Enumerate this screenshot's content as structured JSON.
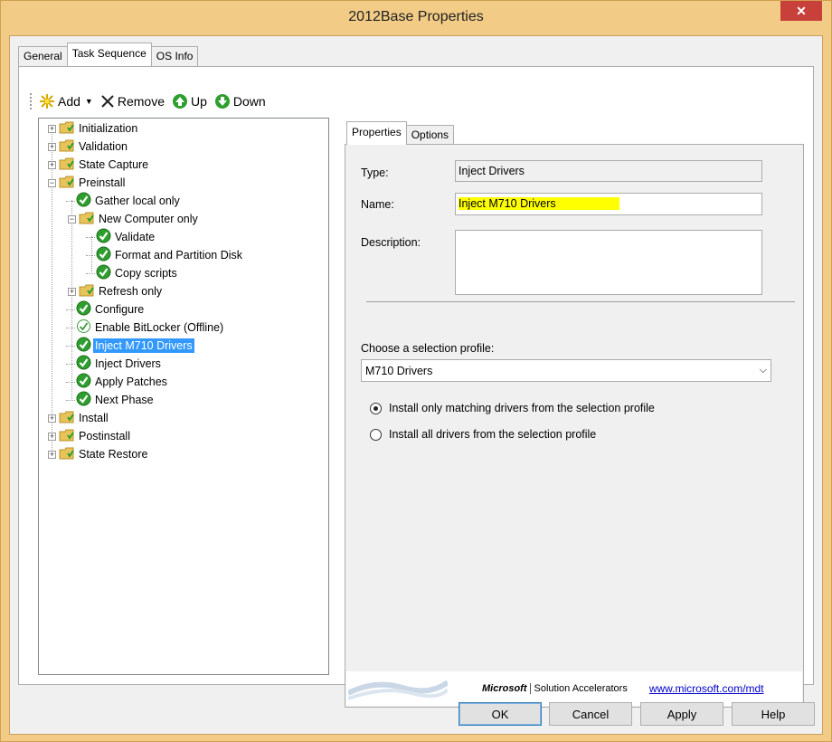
{
  "window": {
    "title": "2012Base Properties",
    "close_label": "✕"
  },
  "top_tabs": [
    {
      "label": "General",
      "active": false
    },
    {
      "label": "Task Sequence",
      "active": true
    },
    {
      "label": "OS Info",
      "active": false
    }
  ],
  "toolbar": {
    "add_label": "Add",
    "remove_label": "Remove",
    "up_label": "Up",
    "down_label": "Down"
  },
  "tree": {
    "nodes": [
      {
        "label": "Initialization",
        "type": "folder",
        "expander": "+"
      },
      {
        "label": "Validation",
        "type": "folder",
        "expander": "+"
      },
      {
        "label": "State Capture",
        "type": "folder",
        "expander": "+"
      },
      {
        "label": "Preinstall",
        "type": "folder",
        "expander": "−"
      },
      {
        "label": "Gather local only",
        "type": "check"
      },
      {
        "label": "New Computer only",
        "type": "folder",
        "expander": "−"
      },
      {
        "label": "Validate",
        "type": "check"
      },
      {
        "label": "Format and Partition Disk",
        "type": "check"
      },
      {
        "label": "Copy scripts",
        "type": "check"
      },
      {
        "label": "Refresh only",
        "type": "folder",
        "expander": "+"
      },
      {
        "label": "Configure",
        "type": "check"
      },
      {
        "label": "Enable BitLocker (Offline)",
        "type": "check-disabled"
      },
      {
        "label": "Inject M710 Drivers",
        "type": "check",
        "selected": true
      },
      {
        "label": "Inject Drivers",
        "type": "check"
      },
      {
        "label": "Apply Patches",
        "type": "check"
      },
      {
        "label": "Next Phase",
        "type": "check"
      },
      {
        "label": "Install",
        "type": "folder",
        "expander": "+"
      },
      {
        "label": "Postinstall",
        "type": "folder",
        "expander": "+"
      },
      {
        "label": "State Restore",
        "type": "folder",
        "expander": "+"
      }
    ]
  },
  "right_tabs": [
    {
      "label": "Properties",
      "active": true
    },
    {
      "label": "Options",
      "active": false
    }
  ],
  "properties": {
    "type_label": "Type:",
    "type_value": "Inject Drivers",
    "name_label": "Name:",
    "name_value": "Inject M710 Drivers",
    "description_label": "Description:",
    "description_value": "",
    "profile_label": "Choose a selection profile:",
    "profile_value": "M710 Drivers",
    "radio_matching": "Install only matching drivers from the selection profile",
    "radio_all": "Install all drivers from the selection profile",
    "radio_selected": "matching"
  },
  "banner": {
    "ms_logo": "Microsoft",
    "ms_product": "Solution Accelerators",
    "link": "www.microsoft.com/mdt"
  },
  "buttons": {
    "ok": "OK",
    "cancel": "Cancel",
    "apply": "Apply",
    "help": "Help"
  },
  "colors": {
    "selection": "#3399ff",
    "highlight": "#ffff00",
    "check_green": "#2e9e2e",
    "folder_yellow": "#e8c35a"
  }
}
